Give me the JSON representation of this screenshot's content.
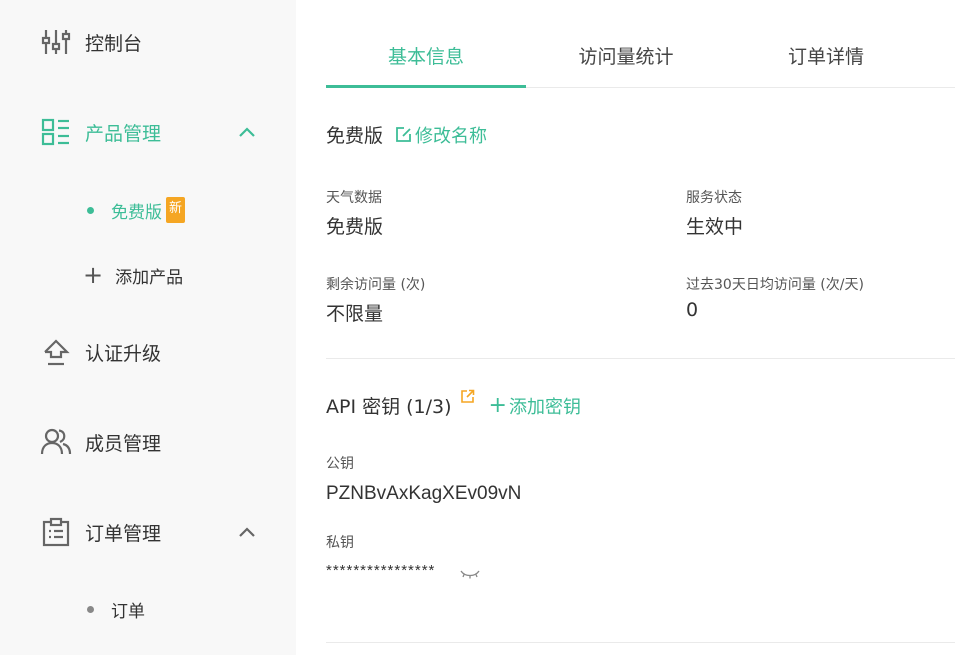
{
  "sidebar": {
    "items": [
      {
        "label": "控制台",
        "icon": "sliders-icon"
      },
      {
        "label": "产品管理",
        "icon": "grid-list-icon",
        "active": true,
        "expanded": true
      },
      {
        "label": "认证升级",
        "icon": "upgrade-icon"
      },
      {
        "label": "成员管理",
        "icon": "users-icon"
      },
      {
        "label": "订单管理",
        "icon": "clipboard-icon",
        "expanded": true
      }
    ],
    "product_sub": {
      "free_label": "免费版",
      "free_badge": "新",
      "add_label": "添加产品"
    },
    "order_sub": {
      "order_label": "订单"
    }
  },
  "tabs": [
    "基本信息",
    "访问量统计",
    "订单详情"
  ],
  "plan": {
    "name": "免费版",
    "rename_link": "修改名称"
  },
  "info": {
    "weather_label": "天气数据",
    "weather_value": "免费版",
    "service_label": "服务状态",
    "service_value": "生效中",
    "remain_label": "剩余访问量 (次)",
    "remain_value": "不限量",
    "avg_label": "过去30天日均访问量 (次/天)",
    "avg_value": "0"
  },
  "api": {
    "title": "API 密钥 (1/3)",
    "add_link": "添加密钥",
    "public_label": "公钥",
    "public_value": "PZNBvAxKagXEv09vN",
    "private_label": "私钥",
    "private_value": "****************"
  },
  "colors": {
    "accent": "#3dbd97",
    "badge": "#f5a623",
    "sidebar_bg": "#f8f8f8"
  }
}
